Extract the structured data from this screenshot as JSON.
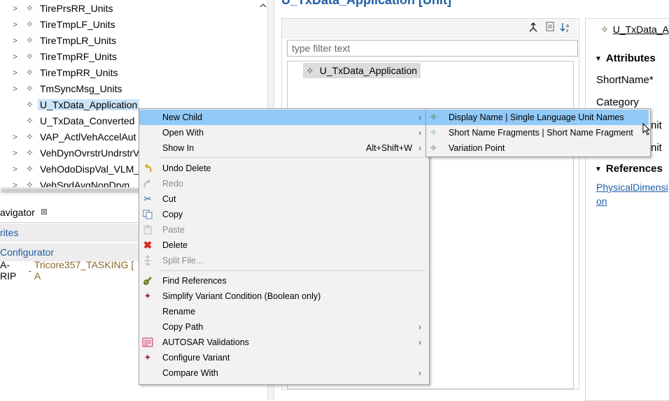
{
  "tree": {
    "items": [
      {
        "label": "TirePrsRR_Units",
        "expandable": true
      },
      {
        "label": "TireTmpLF_Units",
        "expandable": true
      },
      {
        "label": "TireTmpLR_Units",
        "expandable": true
      },
      {
        "label": "TireTmpRF_Units",
        "expandable": true
      },
      {
        "label": "TireTmpRR_Units",
        "expandable": true
      },
      {
        "label": "TmSyncMsg_Units",
        "expandable": true
      },
      {
        "label": "U_TxData_Application",
        "expandable": false,
        "selected": true
      },
      {
        "label": "U_TxData_Converted",
        "expandable": false
      },
      {
        "label": "VAP_ActlVehAccelAut",
        "expandable": true
      },
      {
        "label": "VehDynOvrstrUndrstrV",
        "expandable": true
      },
      {
        "label": "VehOdoDispVal_VLM_",
        "expandable": true
      },
      {
        "label": "VehSpdAvgNonDrvn_",
        "expandable": true
      }
    ],
    "arrow_glyph": ">",
    "element_icon": "✧"
  },
  "navigator": {
    "tab_label": "avigator",
    "close_glyph": "⊠",
    "rows": [
      "rites",
      "Configurator"
    ],
    "project": {
      "name": "A-RIP",
      "sep": " - ",
      "detail": "Tricore357_TASKING [ A"
    }
  },
  "editor": {
    "title": "U_TxData_Application [Unit]",
    "filter_placeholder": "type filter text",
    "root_item": "U_TxData_Application"
  },
  "properties": {
    "header": "U_TxData_Ap",
    "sections": {
      "attributes": "Attributes",
      "references": "References"
    },
    "fields": {
      "short_name": "ShortName*",
      "category": "Category",
      "unit1": "nit",
      "unit2": "nit"
    },
    "link": "PhysicalDimension"
  },
  "context_menu": {
    "items": [
      {
        "label": "New Child",
        "has_submenu": true,
        "highlighted": true
      },
      {
        "label": "Open With",
        "has_submenu": true
      },
      {
        "label": "Show In",
        "accelerator": "Alt+Shift+W",
        "has_submenu": true
      },
      {
        "label": "Undo Delete",
        "icon": "undo-icon"
      },
      {
        "label": "Redo",
        "icon": "redo-icon",
        "disabled": true
      },
      {
        "label": "Cut",
        "icon": "scissors-icon"
      },
      {
        "label": "Copy",
        "icon": "copy-icon"
      },
      {
        "label": "Paste",
        "icon": "paste-icon",
        "disabled": true
      },
      {
        "label": "Delete",
        "icon": "delete-icon"
      },
      {
        "label": "Split File...",
        "icon": "split-icon",
        "disabled": true
      },
      {
        "label": "Find References",
        "icon": "find-references-icon"
      },
      {
        "label": "Simplify Variant Condition (Boolean only)",
        "icon": "variant-icon"
      },
      {
        "label": "Rename"
      },
      {
        "label": "Copy Path",
        "has_submenu": true
      },
      {
        "label": "AUTOSAR Validations",
        "icon": "validation-icon",
        "has_submenu": true
      },
      {
        "label": "Configure Variant",
        "icon": "variant-icon"
      },
      {
        "label": "Compare With",
        "has_submenu": true
      }
    ],
    "submenu_glyph": "›"
  },
  "submenu": {
    "items": [
      {
        "label": "Display Name | Single Language Unit Names",
        "highlighted": true
      },
      {
        "label": "Short Name Fragments | Short Name Fragment"
      },
      {
        "label": "Variation Point"
      }
    ]
  },
  "colors": {
    "highlight": "#91c9f7",
    "selection": "#cce4f7",
    "link": "#1f5ea8",
    "element_icon": "#3d6b2f",
    "menu_bg": "#f2f2f2"
  }
}
